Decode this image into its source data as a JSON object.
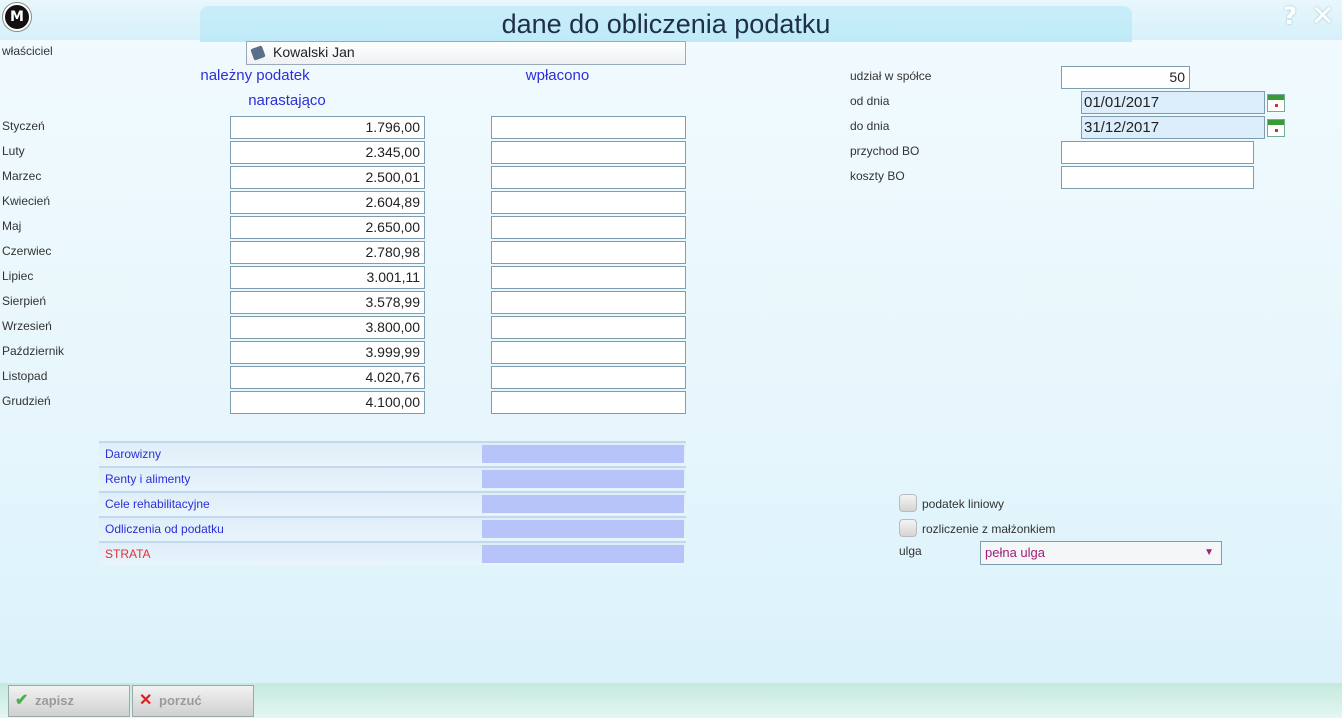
{
  "window": {
    "title": "dane do obliczenia podatku",
    "logo_text": "M",
    "help": "?",
    "close": "✕"
  },
  "owner": {
    "label": "właściciel",
    "value": "Kowalski Jan"
  },
  "columns": {
    "due_line1": "należny podatek",
    "due_line2": "narastająco",
    "paid": "wpłacono"
  },
  "months": [
    {
      "name": "Styczeń",
      "due": "1.796,00",
      "paid": ""
    },
    {
      "name": "Luty",
      "due": "2.345,00",
      "paid": ""
    },
    {
      "name": "Marzec",
      "due": "2.500,01",
      "paid": ""
    },
    {
      "name": "Kwiecień",
      "due": "2.604,89",
      "paid": ""
    },
    {
      "name": "Maj",
      "due": "2.650,00",
      "paid": ""
    },
    {
      "name": "Czerwiec",
      "due": "2.780,98",
      "paid": ""
    },
    {
      "name": "Lipiec",
      "due": "3.001,11",
      "paid": ""
    },
    {
      "name": "Sierpień",
      "due": "3.578,99",
      "paid": ""
    },
    {
      "name": "Wrzesień",
      "due": "3.800,00",
      "paid": ""
    },
    {
      "name": "Październik",
      "due": "3.999,99",
      "paid": ""
    },
    {
      "name": "Listopad",
      "due": "4.020,76",
      "paid": ""
    },
    {
      "name": "Grudzień",
      "due": "4.100,00",
      "paid": ""
    }
  ],
  "deductions": [
    {
      "label": "Darowizny"
    },
    {
      "label": "Renty i alimenty"
    },
    {
      "label": "Cele rehabilitacyjne"
    },
    {
      "label": "Odliczenia od podatku"
    },
    {
      "label": "STRATA"
    }
  ],
  "right": {
    "share_label": "udział w spółce",
    "share_value": "50",
    "from_label": "od dnia",
    "from_value": "01/01/2017",
    "to_label": "do dnia",
    "to_value": "31/12/2017",
    "income_label": "przychod BO",
    "income_value": "",
    "costs_label": "koszty BO",
    "costs_value": ""
  },
  "options": {
    "linear_tax": "podatek liniowy",
    "spouse": "rozliczenie z małżonkiem",
    "relief_label": "ulga",
    "relief_value": "pełna ulga"
  },
  "buttons": {
    "save": "zapisz",
    "discard": "porzuć"
  },
  "colors": {
    "accent": "#2b2fd6",
    "strata": "#e03232",
    "bar": "#b6c4fa"
  }
}
